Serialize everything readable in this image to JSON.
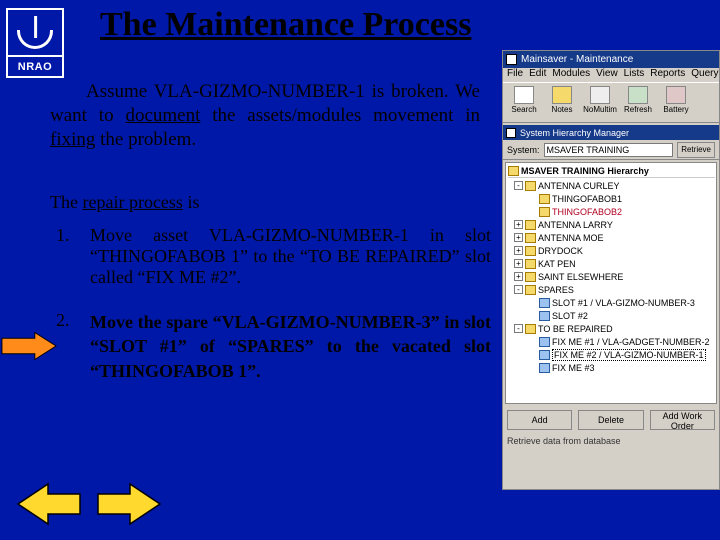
{
  "logo": {
    "text": "NRAO"
  },
  "title": "The Maintenance Process",
  "paragraph": {
    "pre": "Assume VLA-GIZMO-NUMBER-1 is broken.  We want to ",
    "u1": "document",
    "mid": " the assets/modules movement in ",
    "u2": "fixing",
    "post": " the problem."
  },
  "subhead": {
    "pre": "The ",
    "u": "repair process",
    "post": " is"
  },
  "steps": [
    {
      "num": "1.",
      "text": "Move asset VLA-GIZMO-NUMBER-1 in slot “THINGOFABOB 1” to the “TO BE REPAIRED” slot called “FIX ME #2”."
    },
    {
      "num": "2.",
      "text": "Move the spare “VLA-GIZMO-NUMBER-3” in slot “SLOT #1”  of “SPARES” to the vacated slot “THINGOFABOB 1”."
    }
  ],
  "app": {
    "title": "Mainsaver - Maintenance",
    "menus": [
      "File",
      "Edit",
      "Modules",
      "View",
      "Lists",
      "Reports",
      "Query"
    ],
    "toolbar": [
      "Search",
      "Notes",
      "NoMultim",
      "Refresh",
      "Battery"
    ],
    "pane_title": "System Hierarchy Manager",
    "system_label": "System:",
    "system_value": "MSAVER TRAINING",
    "retrieve": "Retrieve",
    "tree_header": "MSAVER TRAINING Hierarchy",
    "tree": [
      {
        "d": 0,
        "pm": "-",
        "ic": "f",
        "t": "ANTENNA CURLEY"
      },
      {
        "d": 1,
        "pm": "",
        "ic": "f",
        "t": "THINGOFABOB1"
      },
      {
        "d": 1,
        "pm": "",
        "ic": "f",
        "t": "THINGOFABOB2",
        "cls": "hl"
      },
      {
        "d": 0,
        "pm": "+",
        "ic": "f",
        "t": "ANTENNA LARRY"
      },
      {
        "d": 0,
        "pm": "+",
        "ic": "f",
        "t": "ANTENNA MOE"
      },
      {
        "d": 0,
        "pm": "+",
        "ic": "f",
        "t": "DRYDOCK"
      },
      {
        "d": 0,
        "pm": "+",
        "ic": "f",
        "t": "KAT PEN"
      },
      {
        "d": 0,
        "pm": "+",
        "ic": "f",
        "t": "SAINT ELSEWHERE"
      },
      {
        "d": 0,
        "pm": "-",
        "ic": "f",
        "t": "SPARES"
      },
      {
        "d": 1,
        "pm": "",
        "ic": "b",
        "t": "SLOT #1 / VLA-GIZMO-NUMBER-3"
      },
      {
        "d": 1,
        "pm": "",
        "ic": "b",
        "t": "SLOT #2"
      },
      {
        "d": 0,
        "pm": "-",
        "ic": "f",
        "t": "TO BE REPAIRED"
      },
      {
        "d": 1,
        "pm": "",
        "ic": "b",
        "t": "FIX ME #1 / VLA-GADGET-NUMBER-2"
      },
      {
        "d": 1,
        "pm": "",
        "ic": "b",
        "t": "FIX ME #2 / VLA-GIZMO-NUMBER-1",
        "sel": true
      },
      {
        "d": 1,
        "pm": "",
        "ic": "b",
        "t": "FIX ME #3"
      }
    ],
    "buttons": [
      "Add",
      "Delete",
      "Add Work Order"
    ],
    "status": "Retrieve data from database"
  }
}
